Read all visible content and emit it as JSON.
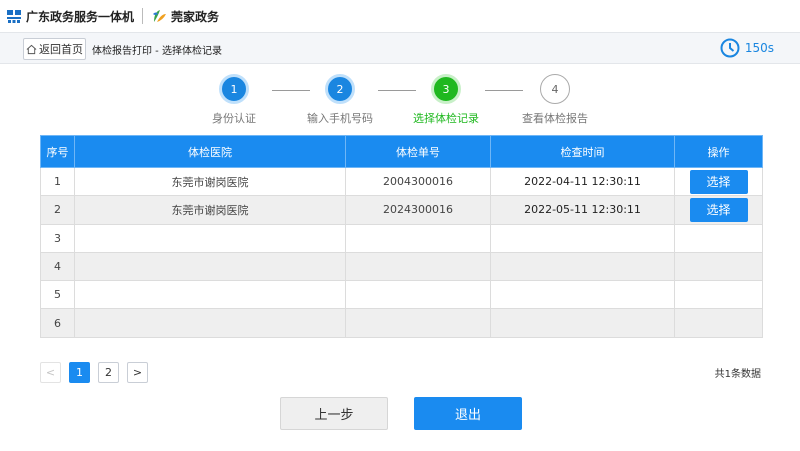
{
  "header": {
    "gov_title": "广东政务服务一体机",
    "dg_title": "莞家政务"
  },
  "subbar": {
    "back_label": "返回首页",
    "breadcrumb": "体检报告打印 - 选择体检记录",
    "countdown": "150s"
  },
  "steps": [
    {
      "num": "1",
      "label": "身份认证",
      "state": "done"
    },
    {
      "num": "2",
      "label": "输入手机号码",
      "state": "done"
    },
    {
      "num": "3",
      "label": "选择体检记录",
      "state": "current"
    },
    {
      "num": "4",
      "label": "查看体检报告",
      "state": "todo"
    }
  ],
  "table": {
    "headers": [
      "序号",
      "体检医院",
      "体检单号",
      "检查时间",
      "操作"
    ],
    "rows": [
      {
        "no": "1",
        "hospital": "东莞市谢岗医院",
        "order": "2004300016",
        "time": "2022-04-11 12:30:11",
        "action": "选择"
      },
      {
        "no": "2",
        "hospital": "东莞市谢岗医院",
        "order": "2024300016",
        "time": "2022-05-11 12:30:11",
        "action": "选择"
      },
      {
        "no": "3",
        "hospital": "",
        "order": "",
        "time": "",
        "action": ""
      },
      {
        "no": "4",
        "hospital": "",
        "order": "",
        "time": "",
        "action": ""
      },
      {
        "no": "5",
        "hospital": "",
        "order": "",
        "time": "",
        "action": ""
      },
      {
        "no": "6",
        "hospital": "",
        "order": "",
        "time": "",
        "action": ""
      }
    ]
  },
  "pagination": {
    "prev": "<",
    "pages": [
      "1",
      "2"
    ],
    "current": "1",
    "next": ">",
    "total": "共1条数据"
  },
  "actions": {
    "prev_step": "上一步",
    "exit": "退出"
  },
  "colors": {
    "primary": "#1a8bf0",
    "current_step": "#1fb81f",
    "row_alt": "#efefef"
  }
}
